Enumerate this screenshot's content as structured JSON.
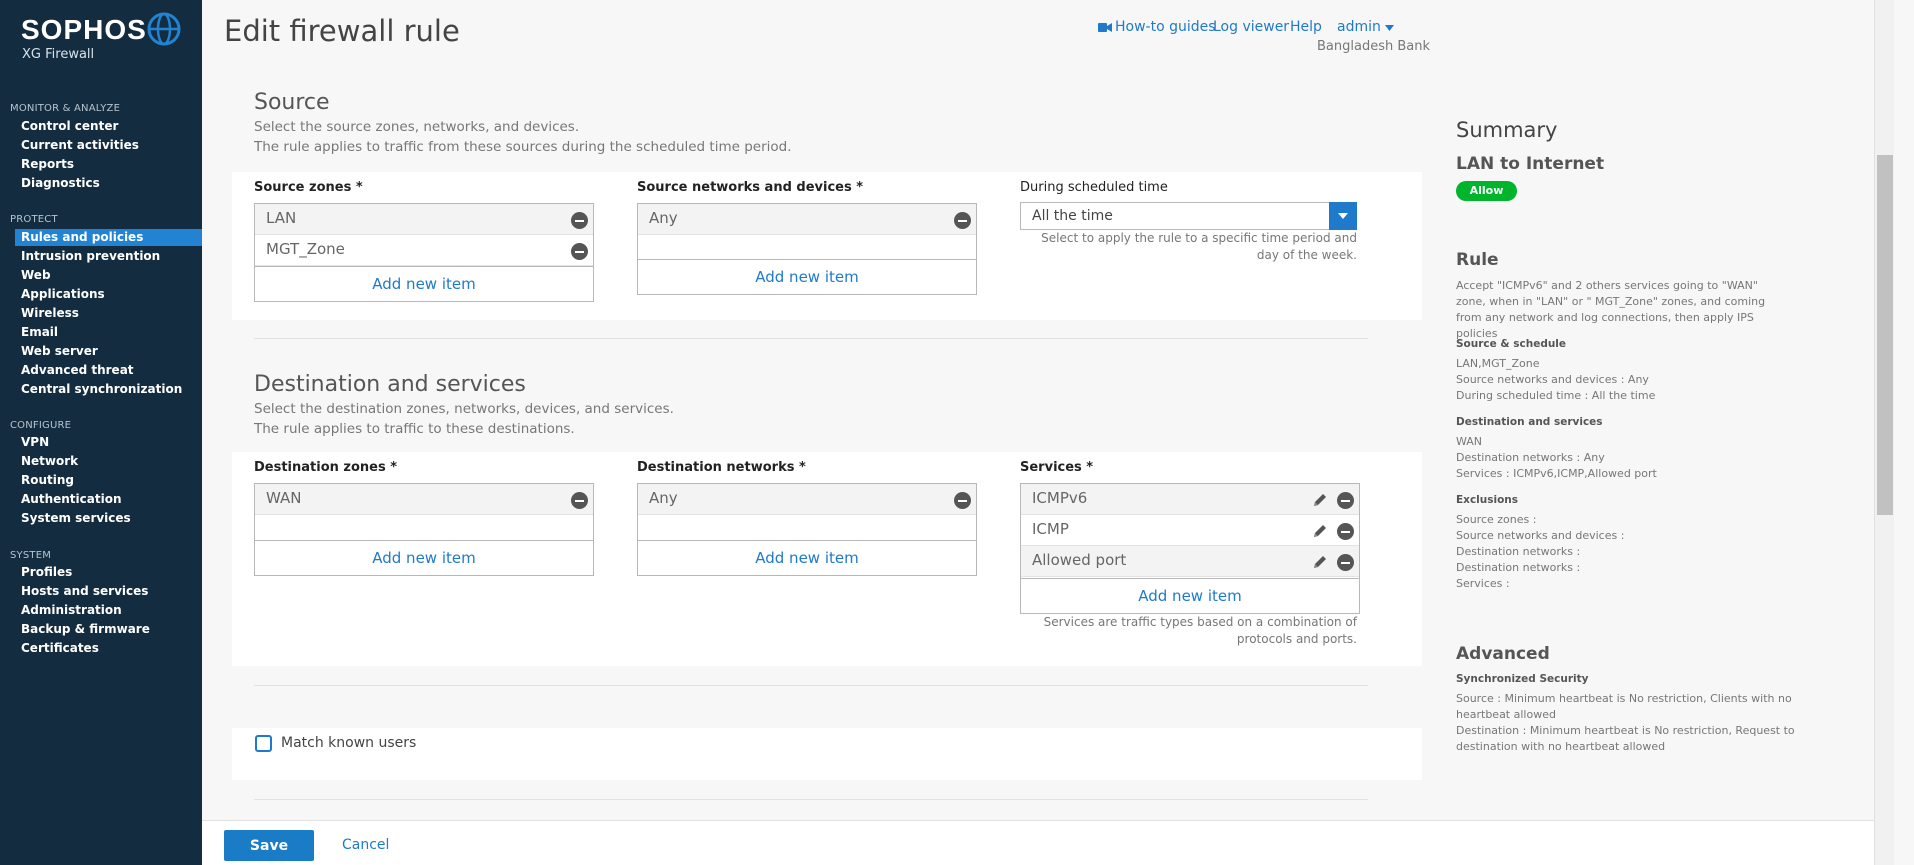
{
  "brand": {
    "name": "SOPHOS",
    "product": "XG Firewall",
    "colors": {
      "sidebar": "#142c3f",
      "accent": "#1f7acb",
      "active": "#2283d2",
      "allow": "#00b52b"
    }
  },
  "sidebar": {
    "sections": [
      {
        "title": "MONITOR & ANALYZE",
        "items": [
          "Control center",
          "Current activities",
          "Reports",
          "Diagnostics"
        ]
      },
      {
        "title": "PROTECT",
        "items": [
          "Rules and policies",
          "Intrusion prevention",
          "Web",
          "Applications",
          "Wireless",
          "Email",
          "Web server",
          "Advanced threat",
          "Central synchronization"
        ]
      },
      {
        "title": "CONFIGURE",
        "items": [
          "VPN",
          "Network",
          "Routing",
          "Authentication",
          "System services"
        ]
      },
      {
        "title": "SYSTEM",
        "items": [
          "Profiles",
          "Hosts and services",
          "Administration",
          "Backup & firmware",
          "Certificates"
        ]
      }
    ],
    "active_item": "Rules and policies"
  },
  "header": {
    "title": "Edit firewall rule",
    "links": {
      "guides": "How-to guides",
      "log": "Log viewer",
      "help": "Help",
      "user": "admin"
    },
    "org": "Bangladesh Bank"
  },
  "source": {
    "title": "Source",
    "desc1": "Select the source zones, networks, and devices.",
    "desc2": "The rule applies to traffic from these sources during the scheduled time period.",
    "zones_label": "Source zones *",
    "zones": [
      "LAN",
      "MGT_Zone"
    ],
    "networks_label": "Source networks and devices *",
    "networks": [
      "Any"
    ],
    "time_label": "During scheduled time",
    "time_value": "All the time",
    "time_hint1": "Select to apply the rule to a specific time period and",
    "time_hint2": "day of the week.",
    "add_label": "Add new item"
  },
  "destination": {
    "title": "Destination and services",
    "desc1": "Select the destination zones, networks, devices, and services.",
    "desc2": "The rule applies to traffic to these destinations.",
    "zones_label": "Destination zones *",
    "zones": [
      "WAN"
    ],
    "networks_label": "Destination networks *",
    "networks": [
      "Any"
    ],
    "services_label": "Services *",
    "services": [
      "ICMPv6",
      "ICMP",
      "Allowed port"
    ],
    "services_hint1": "Services are traffic types based on a combination of",
    "services_hint2": "protocols and ports.",
    "add_label": "Add new item"
  },
  "match_users": {
    "label": "Match known users",
    "checked": false
  },
  "footer": {
    "save": "Save",
    "cancel": "Cancel"
  },
  "summary": {
    "title": "Summary",
    "rule_name": "LAN to Internet",
    "action": "Allow",
    "rule_heading": "Rule",
    "rule_text": "Accept \"ICMPv6\" and 2 others services going to \"WAN\" zone, when in \"LAN\" or \" MGT_Zone\" zones, and coming from any network and log connections, then apply IPS policies",
    "source_heading": "Source & schedule",
    "source_lines": [
      "LAN,MGT_Zone",
      "Source networks and devices : Any",
      "During scheduled time : All the time"
    ],
    "dest_heading": "Destination and services",
    "dest_lines": [
      "WAN",
      "Destination networks : Any",
      "Services : ICMPv6,ICMP,Allowed port"
    ],
    "excl_heading": "Exclusions",
    "excl_lines": [
      "Source zones :",
      "Source networks and devices :",
      "Destination networks :",
      "Destination networks :",
      "Services :"
    ],
    "adv_heading": "Advanced",
    "sync_heading": "Synchronized Security",
    "sync_lines": [
      "Source : Minimum heartbeat is No restriction, Clients with no",
      "heartbeat allowed",
      "Destination : Minimum heartbeat is No restriction, Request to",
      "destination with no heartbeat allowed"
    ]
  }
}
